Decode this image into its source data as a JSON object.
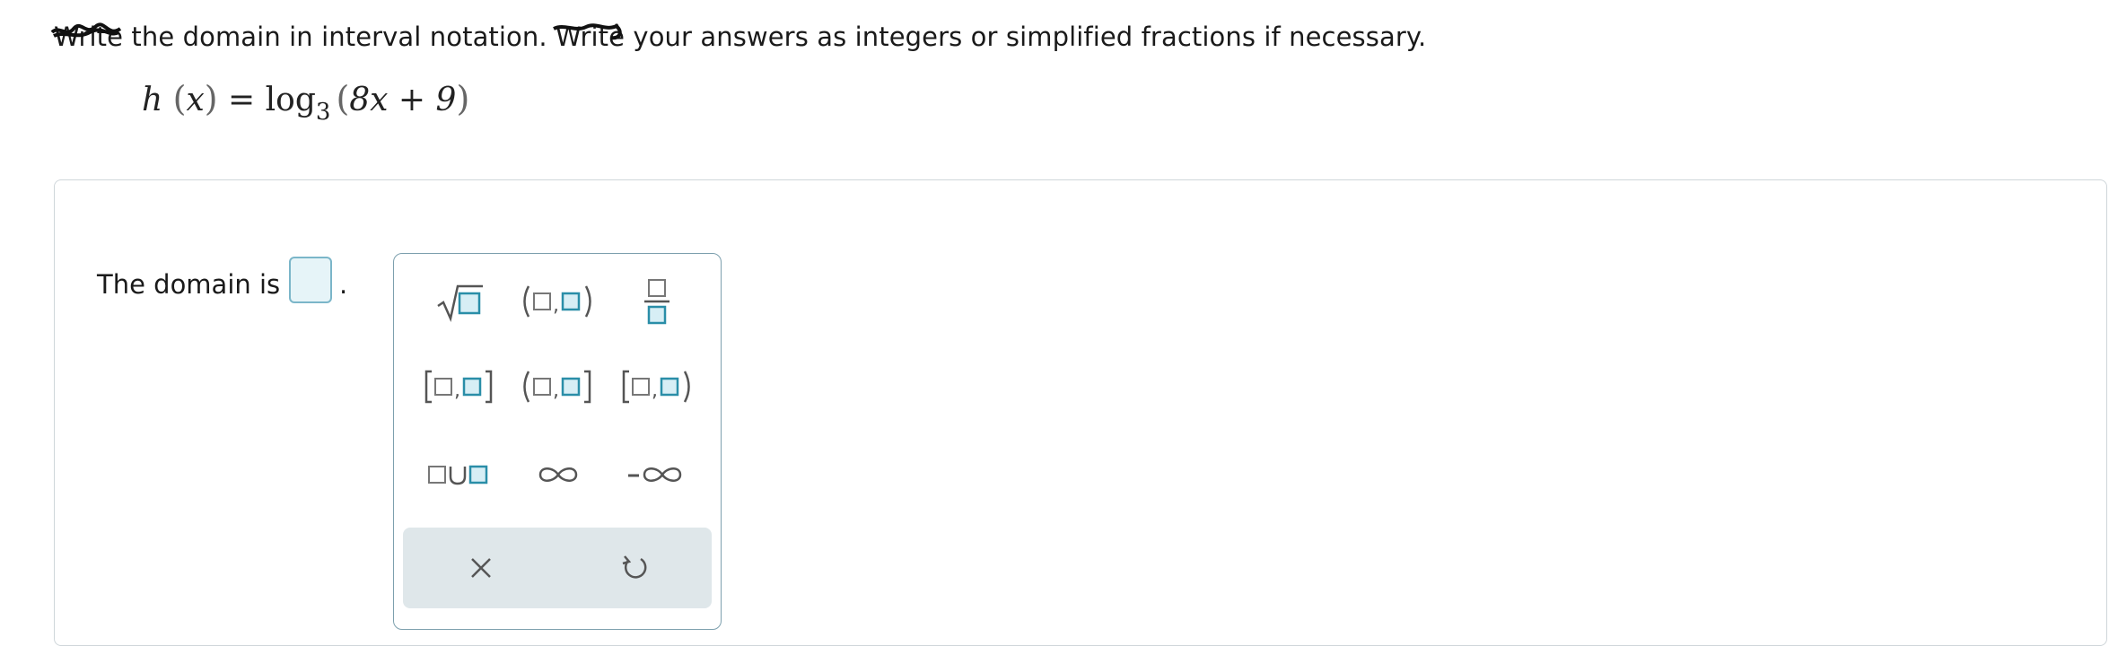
{
  "instructions": {
    "w1": "Write",
    "t1": " the domain in interval notation. ",
    "w2": "Write",
    "t2": " your answers as integers or simplified fractions if necessary."
  },
  "equation": {
    "fn": "h",
    "lparen1": "(",
    "var": "x",
    "rparen1": ")",
    "equals": " = ",
    "log": "log",
    "base": "3",
    "lparen2": "(",
    "arg": "8x + 9",
    "rparen2": ")"
  },
  "answer": {
    "label": "The domain is",
    "value": "",
    "period": "."
  },
  "palette": {
    "keys": [
      {
        "name": "square-root",
        "icon": "sqrt-icon"
      },
      {
        "name": "open-interval",
        "icon": "open-interval-icon"
      },
      {
        "name": "fraction",
        "icon": "fraction-icon"
      },
      {
        "name": "closed-interval",
        "icon": "closed-interval-icon"
      },
      {
        "name": "left-open-right-closed-interval",
        "icon": "half-open-left-icon"
      },
      {
        "name": "left-closed-right-open-interval",
        "icon": "half-open-right-icon"
      },
      {
        "name": "union",
        "icon": "union-icon"
      },
      {
        "name": "infinity",
        "icon": "infinity-icon"
      },
      {
        "name": "negative-infinity",
        "icon": "negative-infinity-icon"
      }
    ],
    "tools": [
      {
        "name": "clear",
        "icon": "close-icon"
      },
      {
        "name": "undo",
        "icon": "undo-icon"
      }
    ]
  },
  "colors": {
    "accent": "#2a8ea8",
    "accent_fill": "#e6f4f8",
    "palette_border": "#7da0ae",
    "tool_bar": "#dfe7ea"
  }
}
